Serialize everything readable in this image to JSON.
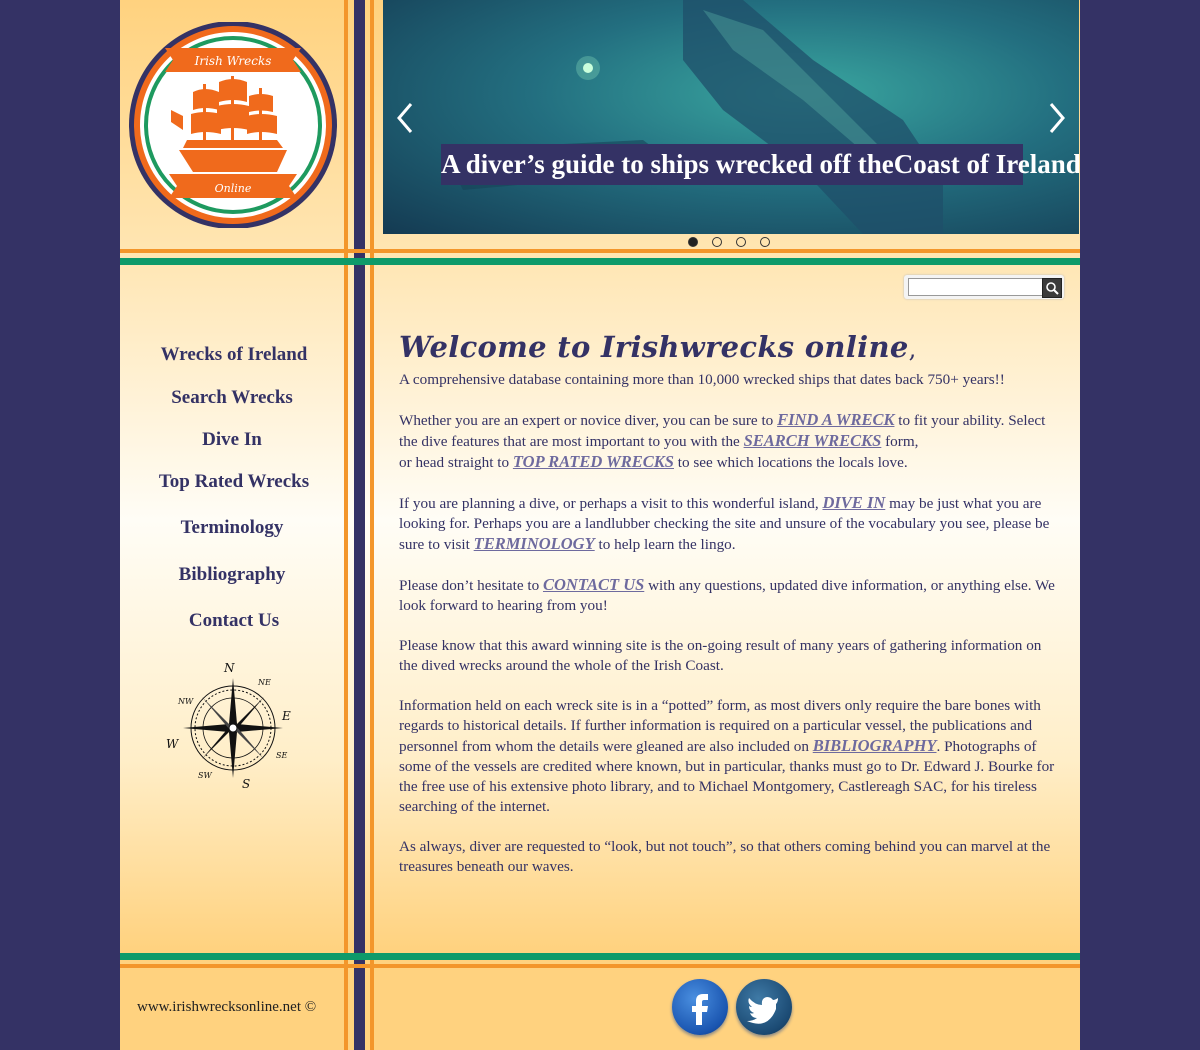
{
  "logo": {
    "top_banner": "Irish Wrecks",
    "bottom_banner": "Online"
  },
  "banner": {
    "tagline": "A diver’s guide to ships wrecked off theCoast of Ireland",
    "prev_icon": "chevron-left-icon",
    "next_icon": "chevron-right-icon",
    "slides": 4,
    "active_slide": 1
  },
  "search": {
    "value": "",
    "placeholder": "",
    "button_icon": "search-icon"
  },
  "nav": {
    "items": [
      {
        "label": "Wrecks of Ireland"
      },
      {
        "label": "Search Wrecks"
      },
      {
        "label": "Dive In"
      },
      {
        "label": "Top Rated Wrecks"
      },
      {
        "label": "Terminology"
      },
      {
        "label": "Bibliography"
      },
      {
        "label": "Contact Us"
      }
    ],
    "compass_letters": [
      "N",
      "NE",
      "E",
      "SE",
      "S",
      "SW",
      "W",
      "NW"
    ]
  },
  "main": {
    "title": "Welcome to Irishwrecks online",
    "title_suffix": ",",
    "p1": "A comprehensive database containing more than 10,000 wrecked ships that dates back 750+ years!!",
    "p2": {
      "t1": "Whether you are an expert or novice diver, you can be sure to ",
      "link1": "FIND A WRECK",
      "t2": " to fit your ability. Select the dive features that are most important to you with the ",
      "link2": "SEARCH WRECKS",
      "t3": " form,",
      "t4": "or head straight to ",
      "link3": "TOP RATED WRECKS",
      "t5": " to see which locations the locals love."
    },
    "p3": {
      "t1": "If you are planning a dive, or perhaps a visit to this wonderful island, ",
      "link1": "DIVE IN",
      "t2": " may be just what you are looking for. Perhaps you are a landlubber checking the site and unsure of the vocabulary you see, please be sure to visit ",
      "link2": "TERMINOLOGY",
      "t3": " to help learn the lingo."
    },
    "p4": {
      "t1": "Please don’t hesitate to ",
      "link1": "CONTACT US",
      "t2": " with any questions, updated dive information, or anything else. We look forward to hearing from you!"
    },
    "p5": "Please know that this award winning site is the on-going result of many years of gathering information on the dived wrecks around the whole of the Irish Coast.",
    "p6": {
      "t1": "Information held on each wreck site is in a “potted” form, as most divers only require the bare bones with regards to historical details.  If further information is required on a particular vessel, the publications and personnel from whom the details were gleaned are also included on ",
      "link1": "BIBLIOGRAPHY",
      "t2": ".  Photographs of some of the vessels are credited where known, but in particular, thanks must go to Dr. Edward J. Bourke for the free use of his extensive photo library, and to Michael Montgomery, Castlereagh SAC, for his tireless searching of the internet."
    },
    "p7": "As always, diver are requested to “look, but not touch”, so that others coming behind you can marvel at the treasures beneath our waves."
  },
  "footer": {
    "copyright": "www.irishwrecksonline.net ©",
    "social": [
      {
        "name": "facebook",
        "icon": "facebook-icon"
      },
      {
        "name": "twitter",
        "icon": "twitter-icon"
      }
    ]
  },
  "colors": {
    "navy": "#343265",
    "orange": "#f3962b",
    "green": "#0e9a6a",
    "link": "#6e6a9e",
    "page_bg": "#ffd27f"
  }
}
